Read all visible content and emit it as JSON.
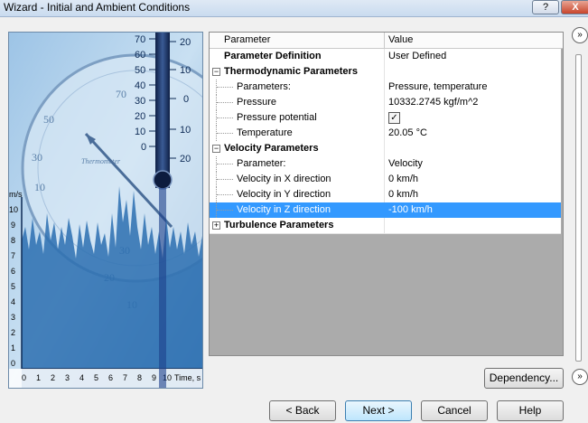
{
  "window": {
    "title": "Wizard - Initial and Ambient Conditions",
    "help_glyph": "?",
    "close_glyph": "X"
  },
  "illustration": {
    "thermometer_left_ticks": [
      "70",
      "60",
      "50",
      "40",
      "30",
      "20",
      "10",
      "0"
    ],
    "thermometer_right_ticks": [
      "20",
      "10",
      "0",
      "10",
      "20"
    ],
    "dial_labels": [
      "50",
      "30",
      "10",
      "30",
      "20",
      "10",
      "70",
      "Thermometer"
    ],
    "chart_ylabel": "m/s",
    "chart_yticks": [
      "10",
      "9",
      "8",
      "7",
      "6",
      "5",
      "4",
      "3",
      "2",
      "1",
      "0"
    ],
    "chart_xticks": [
      "0",
      "1",
      "2",
      "3",
      "4",
      "5",
      "6",
      "7",
      "8",
      "9",
      "10"
    ],
    "chart_xlabel": "Time, s"
  },
  "grid": {
    "col_parameter": "Parameter",
    "col_value": "Value",
    "rows": [
      {
        "name": "Parameter Definition",
        "value": "User Defined"
      },
      {
        "name": "Thermodynamic Parameters",
        "value": ""
      },
      {
        "name": "Parameters:",
        "value": "Pressure, temperature"
      },
      {
        "name": "Pressure",
        "value": "10332.2745 kgf/m^2"
      },
      {
        "name": "Pressure potential",
        "value": "✓"
      },
      {
        "name": "Temperature",
        "value": "20.05 °C"
      },
      {
        "name": "Velocity Parameters",
        "value": ""
      },
      {
        "name": "Parameter:",
        "value": "Velocity"
      },
      {
        "name": "Velocity in X direction",
        "value": "0 km/h"
      },
      {
        "name": "Velocity in Y direction",
        "value": "0 km/h"
      },
      {
        "name": "Velocity in Z direction",
        "value": "-100 km/h"
      },
      {
        "name": "Turbulence Parameters",
        "value": ""
      }
    ],
    "expander_minus": "−",
    "expander_plus": "+"
  },
  "buttons": {
    "collapse": "»",
    "dependency": "Dependency...",
    "back": "< Back",
    "next": "Next >",
    "cancel": "Cancel",
    "help": "Help"
  },
  "colors": {
    "selection": "#3399ff",
    "image_blue": "#3b78b8"
  }
}
